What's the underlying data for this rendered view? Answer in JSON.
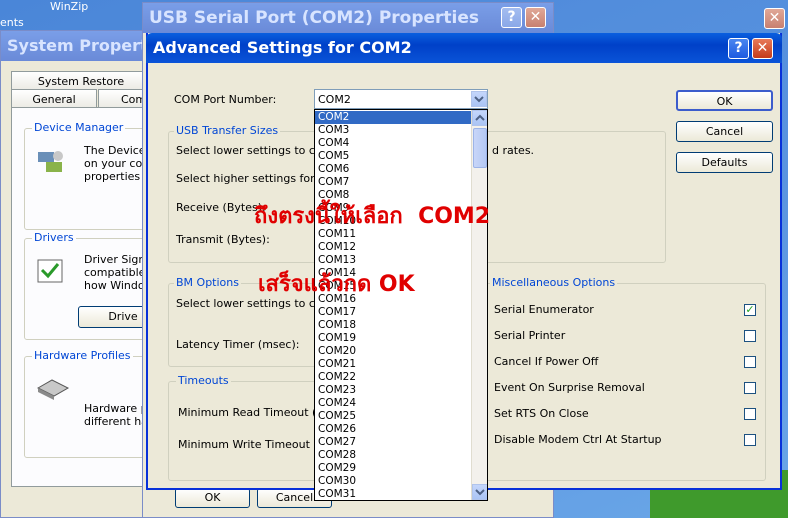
{
  "desktop": {
    "winzip_label": "WinZip",
    "ents_label": "ents"
  },
  "system_props": {
    "title": "System Propert",
    "tabs_row1": [
      "System Restore"
    ],
    "tabs_row2": [
      "General",
      "Com"
    ],
    "device_manager": {
      "label": "Device Manager",
      "text": [
        "The Device",
        "on your comp",
        "properties of"
      ]
    },
    "drivers": {
      "label": "Drivers",
      "text": [
        "Driver Signin",
        "compatible w",
        "how Window"
      ],
      "button": "Drive"
    },
    "hardware_profiles": {
      "label": "Hardware Profiles",
      "text": [
        "Hardware pr",
        "different hard"
      ]
    },
    "ok": "OK",
    "cancel": "Cancel"
  },
  "usb_props": {
    "title": "USB Serial Port (COM2) Properties"
  },
  "advanced": {
    "title": "Advanced Settings for COM2",
    "com_port_label": "COM Port Number:",
    "com_port_value": "COM2",
    "usb_transfer": {
      "label": "USB Transfer Sizes",
      "lower": "Select lower settings to corre",
      "higher": "Select higher settings for fas",
      "rates": "d rates.",
      "receive": "Receive (Bytes):",
      "transmit": "Transmit (Bytes):"
    },
    "bm_options": {
      "label": "BM Options",
      "lower": "Select lower settings to corre",
      "latency": "Latency Timer (msec):"
    },
    "timeouts": {
      "label": "Timeouts",
      "read": "Minimum Read Timeout (mse",
      "write": "Minimum Write Timeout (mse"
    },
    "misc": {
      "label": "Miscellaneous Options",
      "items": [
        {
          "label": "Serial Enumerator",
          "checked": "✓"
        },
        {
          "label": "Serial Printer",
          "checked": ""
        },
        {
          "label": "Cancel If Power Off",
          "checked": ""
        },
        {
          "label": "Event On Surprise Removal",
          "checked": ""
        },
        {
          "label": "Set RTS On Close",
          "checked": ""
        },
        {
          "label": "Disable Modem Ctrl At Startup",
          "checked": ""
        }
      ]
    },
    "ok": "OK",
    "cancel": "Cancel",
    "defaults": "Defaults",
    "list": [
      "COM2",
      "COM3",
      "COM4",
      "COM5",
      "COM6",
      "COM7",
      "COM8",
      "COM9",
      "COM10",
      "COM11",
      "COM12",
      "COM13",
      "COM14",
      "COM15",
      "COM16",
      "COM17",
      "COM18",
      "COM19",
      "COM20",
      "COM21",
      "COM22",
      "COM23",
      "COM24",
      "COM25",
      "COM26",
      "COM27",
      "COM28",
      "COM29",
      "COM30",
      "COM31"
    ]
  },
  "annotation": {
    "line1_thai": "ถึงตรงนี้ให้เลือก",
    "line1_com": "COM2",
    "line2": "เสร็จแล้วกด OK"
  },
  "colors": {
    "annotation": "#e00000",
    "selection": "#316ac5",
    "group_label": "#0046d5"
  }
}
